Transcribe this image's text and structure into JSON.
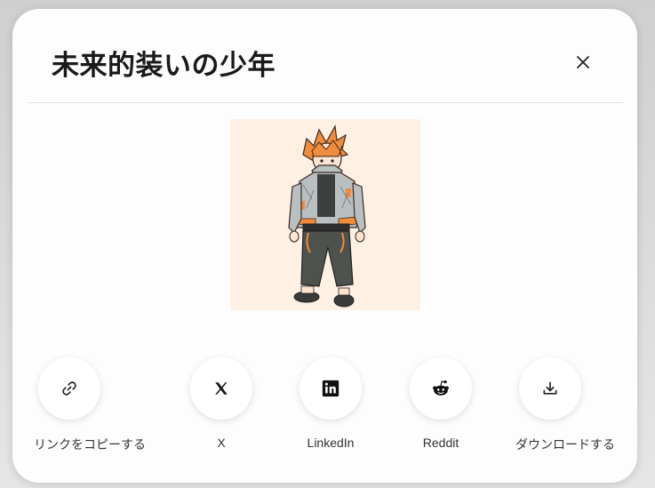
{
  "modal": {
    "title": "未来的装いの少年"
  },
  "icons": {
    "close": "close-icon",
    "copy_link": "link-icon",
    "x": "x-logo-icon",
    "linkedin": "linkedin-logo-icon",
    "reddit": "reddit-logo-icon",
    "download": "download-icon"
  },
  "share": {
    "copy_link_label": "リンクをコピーする",
    "x_label": "X",
    "linkedin_label": "LinkedIn",
    "reddit_label": "Reddit",
    "download_label": "ダウンロードする"
  },
  "colors": {
    "preview_background": "#fef1e4",
    "hair": "#f08c3c",
    "jacket": "#b9c0c2",
    "pants": "#4e524e"
  }
}
